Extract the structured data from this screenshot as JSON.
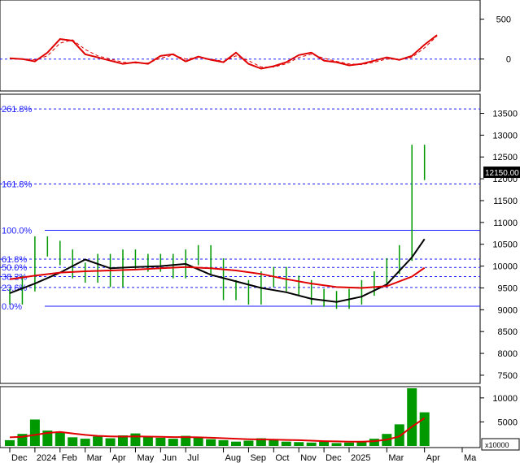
{
  "chart_data": [
    {
      "type": "line",
      "panel": "oscillator",
      "y_ticks": [
        0,
        500
      ],
      "y_tick_labels": [
        "0",
        "500"
      ],
      "ylim": [
        -380,
        720
      ],
      "reference_line": 0,
      "x": [
        0,
        2,
        4,
        6,
        8,
        10,
        12,
        14,
        16,
        18,
        20,
        22,
        24,
        26,
        28,
        30,
        32,
        34,
        36,
        38,
        40,
        42,
        44,
        46,
        48,
        50,
        52,
        54,
        56,
        58,
        60,
        62,
        64,
        66,
        68
      ],
      "series": [
        {
          "values": [
            10,
            0,
            -30,
            80,
            250,
            230,
            60,
            20,
            -20,
            -60,
            -40,
            -60,
            40,
            60,
            -30,
            30,
            -10,
            -40,
            80,
            -60,
            -120,
            -90,
            -40,
            50,
            80,
            -20,
            -40,
            -80,
            -60,
            -20,
            20,
            -10,
            40,
            180,
            300
          ],
          "color": "#e00000"
        },
        {
          "values": [
            5,
            5,
            -10,
            40,
            200,
            240,
            120,
            40,
            0,
            -40,
            -50,
            -50,
            10,
            50,
            0,
            20,
            0,
            -30,
            40,
            -20,
            -100,
            -100,
            -60,
            20,
            60,
            10,
            -30,
            -60,
            -70,
            -40,
            0,
            -5,
            20,
            140,
            290
          ],
          "color": "#e00000",
          "dashed": true
        }
      ]
    },
    {
      "type": "line",
      "panel": "price",
      "y_ticks": [
        7500,
        8000,
        8500,
        9000,
        9500,
        10000,
        10500,
        11000,
        11500,
        12000,
        12500,
        13000,
        13500
      ],
      "y_tick_labels": [
        "7500",
        "8000",
        "8500",
        "9000",
        "9500",
        "10000",
        "10500",
        "11000",
        "11500",
        "12000",
        "12500",
        "13000",
        "13500"
      ],
      "ylim": [
        7350,
        13900
      ],
      "last_price_label": "12150.00",
      "fibonacci": {
        "labels": [
          "261.8%",
          "161.8%",
          "100.0%",
          "61.8%",
          "50.0%",
          "38.2%",
          "23.6%",
          "0.0%"
        ],
        "levels": [
          13600,
          11880,
          10820,
          10160,
          9970,
          9760,
          9510,
          9080
        ]
      },
      "x_labels": [
        "Dec",
        "2024",
        "Feb",
        "Mar",
        "Apr",
        "May",
        "Jun",
        "Jul",
        "Aug",
        "Sep",
        "Oct",
        "Nov",
        "Dec",
        "2025",
        "Mar",
        "Apr",
        "Ma"
      ],
      "x_label_positions": [
        0,
        2,
        4,
        6,
        8,
        10,
        12,
        14,
        17,
        19,
        21,
        23,
        25,
        27,
        30,
        33,
        36
      ],
      "series": [
        {
          "name": "",
          "color": "#000000",
          "x": [
            0,
            2,
            4,
            6,
            8,
            10,
            12,
            14,
            16,
            18,
            20,
            22,
            24,
            26,
            28,
            30,
            32,
            33
          ],
          "values": [
            9380,
            9600,
            9850,
            10150,
            9950,
            9980,
            10000,
            10050,
            9800,
            9650,
            9500,
            9400,
            9250,
            9180,
            9300,
            9580,
            10200,
            10620
          ]
        },
        {
          "name": "",
          "color": "#e00000",
          "x": [
            0,
            2,
            4,
            6,
            8,
            10,
            12,
            14,
            16,
            18,
            20,
            22,
            24,
            26,
            28,
            30,
            32,
            33
          ],
          "values": [
            9700,
            9780,
            9850,
            9880,
            9900,
            9920,
            9950,
            9980,
            9950,
            9900,
            9820,
            9700,
            9600,
            9520,
            9500,
            9540,
            9760,
            9960
          ]
        },
        {
          "name": "",
          "color": "#009900",
          "style": "ohlc",
          "x": [
            0,
            1,
            2,
            3,
            4,
            5,
            6,
            7,
            8,
            9,
            10,
            11,
            12,
            13,
            14,
            15,
            16,
            17,
            18,
            19,
            20,
            21,
            22,
            23,
            24,
            25,
            26,
            27,
            28,
            29,
            30,
            31,
            32,
            33
          ],
          "values": [
            9300,
            9600,
            10500,
            10400,
            10200,
            9900,
            9800,
            10100,
            9700,
            10200,
            10100,
            10050,
            10100,
            9900,
            10200,
            10300,
            10000,
            9400,
            9500,
            9300,
            9700,
            9800,
            9600,
            9500,
            9300,
            9250,
            9200,
            9300,
            9500,
            9700,
            10000,
            10300,
            12600,
            12150
          ]
        }
      ]
    },
    {
      "type": "bar",
      "panel": "volume",
      "y_ticks": [
        5000,
        10000
      ],
      "y_tick_labels": [
        "5000",
        "10000"
      ],
      "multiplier_label": "x10000",
      "ylim": [
        0,
        12000
      ],
      "x": [
        0,
        1,
        2,
        3,
        4,
        5,
        6,
        7,
        8,
        9,
        10,
        11,
        12,
        13,
        14,
        15,
        16,
        17,
        18,
        19,
        20,
        21,
        22,
        23,
        24,
        25,
        26,
        27,
        28,
        29,
        30,
        31,
        32,
        33
      ],
      "values": [
        1200,
        2500,
        5500,
        3200,
        2800,
        1800,
        1500,
        2000,
        1600,
        2200,
        2600,
        1900,
        1700,
        1500,
        2100,
        1800,
        1400,
        1200,
        900,
        1100,
        1600,
        1300,
        900,
        800,
        700,
        900,
        600,
        700,
        800,
        1500,
        2500,
        4500,
        12000,
        7000
      ],
      "color": "#009900",
      "ma_series": {
        "color": "#e00000",
        "values": [
          1800,
          1900,
          2300,
          2700,
          2900,
          2600,
          2300,
          2100,
          2000,
          1950,
          2000,
          1950,
          1900,
          1850,
          1850,
          1800,
          1700,
          1600,
          1500,
          1400,
          1350,
          1300,
          1250,
          1200,
          1100,
          1000,
          950,
          900,
          900,
          1000,
          1300,
          2000,
          4000,
          5800
        ]
      }
    }
  ]
}
